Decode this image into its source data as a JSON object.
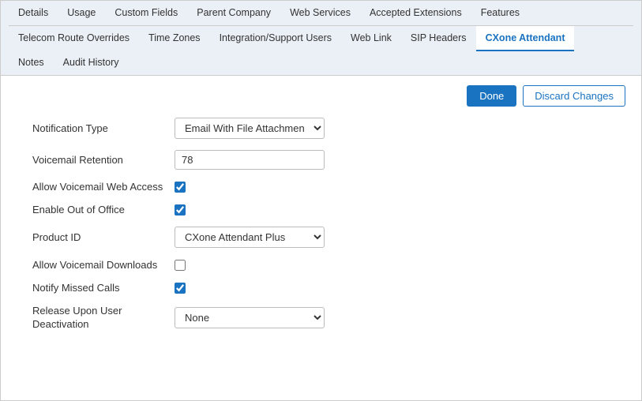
{
  "tabs": {
    "row1": [
      {
        "label": "Details",
        "active": false
      },
      {
        "label": "Usage",
        "active": false
      },
      {
        "label": "Custom Fields",
        "active": false
      },
      {
        "label": "Parent Company",
        "active": false
      },
      {
        "label": "Web Services",
        "active": false
      },
      {
        "label": "Accepted Extensions",
        "active": false
      },
      {
        "label": "Features",
        "active": false
      }
    ],
    "row2": [
      {
        "label": "Telecom Route Overrides",
        "active": false
      },
      {
        "label": "Time Zones",
        "active": false
      },
      {
        "label": "Integration/Support Users",
        "active": false
      },
      {
        "label": "Web Link",
        "active": false
      },
      {
        "label": "SIP Headers",
        "active": false
      },
      {
        "label": "CXone Attendant",
        "active": true
      }
    ],
    "row3": [
      {
        "label": "Notes",
        "active": false
      },
      {
        "label": "Audit History",
        "active": false
      }
    ]
  },
  "toolbar": {
    "done_label": "Done",
    "discard_label": "Discard Changes"
  },
  "form": {
    "notification_type_label": "Notification Type",
    "notification_type_value": "Email With File Attachment",
    "voicemail_retention_label": "Voicemail Retention",
    "voicemail_retention_value": "78",
    "allow_voicemail_web_access_label": "Allow Voicemail Web Access",
    "enable_out_of_office_label": "Enable Out of Office",
    "product_id_label": "Product ID",
    "product_id_value": "CXone Attendant Plus",
    "allow_voicemail_downloads_label": "Allow Voicemail Downloads",
    "notify_missed_calls_label": "Notify Missed Calls",
    "release_upon_user_deactivation_label_line1": "Release Upon User",
    "release_upon_user_deactivation_label_line2": "Deactivation",
    "release_upon_user_deactivation_value": "None"
  }
}
